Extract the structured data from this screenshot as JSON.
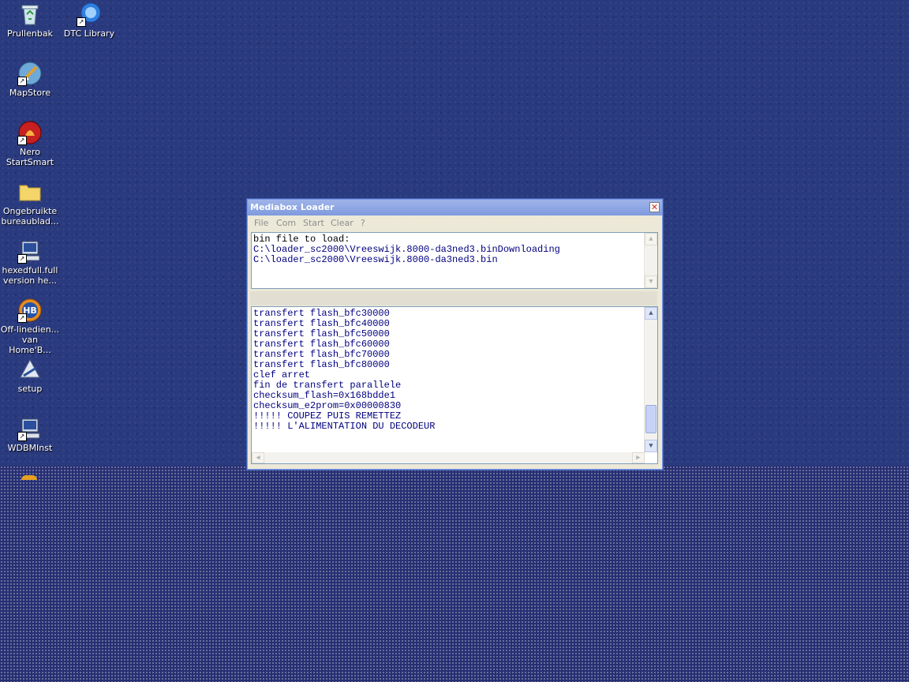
{
  "desktop": {
    "icons": [
      {
        "label": "Prullenbak",
        "icon": "recycle-bin-icon"
      },
      {
        "label": "DTC Library",
        "icon": "dtc-library-icon"
      },
      {
        "label": "MapStore",
        "icon": "mapstore-icon"
      },
      {
        "label": "Nero StartSmart",
        "icon": "nero-icon"
      },
      {
        "label": "Ongebruikte bureaublad...",
        "icon": "folder-icon"
      },
      {
        "label": "hexedfull.full version he...",
        "icon": "installer-icon"
      },
      {
        "label": "Off-linedien... van Home'B...",
        "icon": "homebanking-icon"
      },
      {
        "label": "setup",
        "icon": "setup-icon"
      },
      {
        "label": "WDBMInst",
        "icon": "installer-icon"
      }
    ]
  },
  "window": {
    "title": "Mediabox Loader",
    "close_glyph": "✕",
    "menu": [
      "File",
      "Com",
      "Start",
      "Clear",
      "?"
    ],
    "top_log": [
      "bin file to load:",
      "C:\\loader_sc2000\\Vreeswijk.8000-da3ned3.binDownloading",
      "C:\\loader_sc2000\\Vreeswijk.8000-da3ned3.bin"
    ],
    "bottom_log": [
      "transfert flash_bfc30000",
      "transfert flash_bfc40000",
      "transfert flash_bfc50000",
      "transfert flash_bfc60000",
      "transfert flash_bfc70000",
      "transfert flash_bfc80000",
      "clef arret",
      "fin de transfert parallele",
      "checksum_flash=0x168bdde1",
      "checksum_e2prom=0x00000830",
      "!!!!! COUPEZ PUIS REMETTEZ",
      "!!!!! L'ALIMENTATION DU DECODEUR"
    ]
  },
  "colors": {
    "desktop_blue": "#2a3a7e",
    "title_blue": "#8aa2e2",
    "log_text": "#000080"
  }
}
